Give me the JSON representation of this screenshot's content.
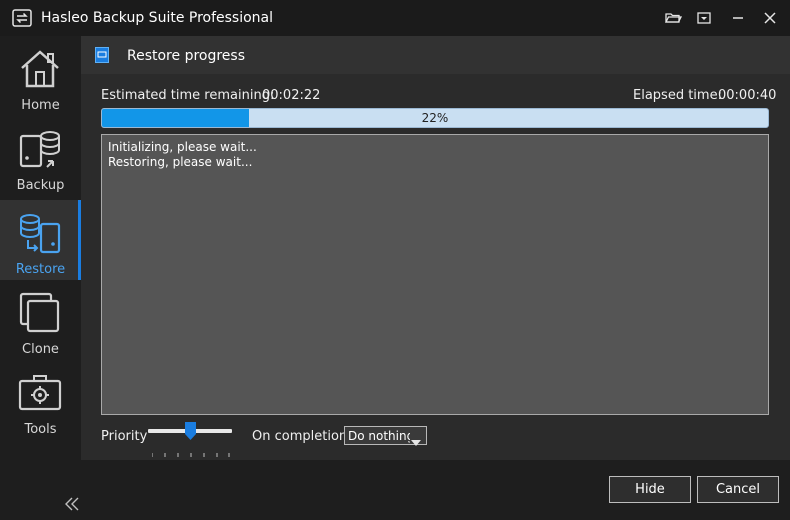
{
  "window": {
    "title": "Hasleo Backup Suite Professional",
    "icons": {
      "app": "backup-app-icon",
      "open": "folder-open-icon",
      "menu": "dropdown-menu-icon",
      "minimize": "minimize-icon",
      "close": "close-icon"
    }
  },
  "sidebar": {
    "items": [
      {
        "label": "Home",
        "icon": "home-icon"
      },
      {
        "label": "Backup",
        "icon": "backup-icon"
      },
      {
        "label": "Restore",
        "icon": "restore-icon",
        "active": true
      },
      {
        "label": "Clone",
        "icon": "clone-icon"
      },
      {
        "label": "Tools",
        "icon": "toolbox-icon"
      }
    ],
    "collapse_icon": "double-chevron-left-icon"
  },
  "colors": {
    "accent": "#1a7de0",
    "progress_fill": "#1296e8",
    "progress_bg": "#c9dff2",
    "active_label": "#4aa3f0"
  },
  "header": {
    "title": "Restore progress",
    "icon": "restore-panel-icon"
  },
  "progress": {
    "remaining_label": "Estimated time remaining:",
    "remaining_value": "00:02:22",
    "elapsed_label": "Elapsed time:",
    "elapsed_value": "00:00:40",
    "percent": 22,
    "percent_text": "22%"
  },
  "log": {
    "lines": [
      "Initializing, please wait...",
      "Restoring, please wait..."
    ]
  },
  "options": {
    "priority_label": "Priority",
    "priority_level": 0.5,
    "completion_label": "On completion",
    "completion_value": "Do nothing"
  },
  "buttons": {
    "hide": "Hide",
    "cancel": "Cancel"
  }
}
